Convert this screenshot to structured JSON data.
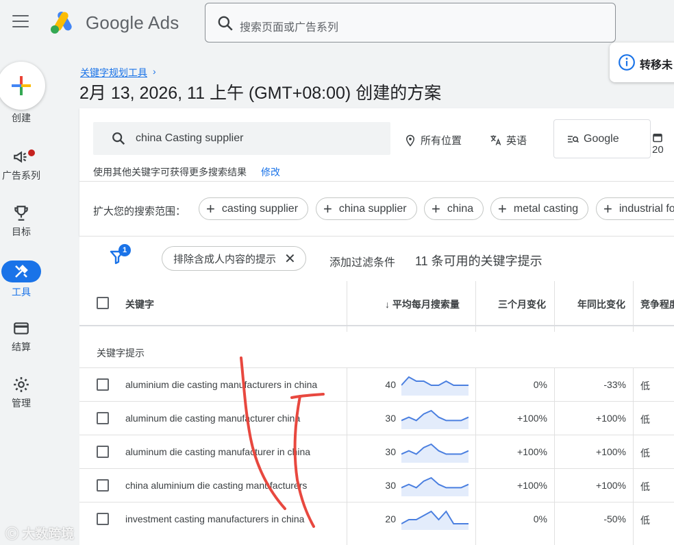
{
  "header": {
    "brand": "Google Ads",
    "search_placeholder": "搜索页面或广告系列",
    "toast_text": "转移未"
  },
  "sidebar": {
    "create_label": "创建",
    "items": [
      {
        "label": "广告系列",
        "icon": "megaphone-icon"
      },
      {
        "label": "目标",
        "icon": "trophy-icon"
      },
      {
        "label": "工具",
        "icon": "tools-icon",
        "active": true
      },
      {
        "label": "结算",
        "icon": "credit-card-icon"
      },
      {
        "label": "管理",
        "icon": "gear-icon"
      }
    ]
  },
  "page": {
    "breadcrumb": "关键字规划工具",
    "title": "2月 13, 2026, 11 上午 (GMT+08:00) 创建的方案"
  },
  "search_card": {
    "keyword_value": "china Casting supplier",
    "location": "所有位置",
    "language": "英语",
    "network": "Google",
    "date_partial": "20",
    "hint_text": "使用其他关键字可获得更多搜索结果",
    "hint_link": "修改",
    "expand_label": "扩大您的搜索范围：",
    "chips": [
      "casting supplier",
      "china supplier",
      "china",
      "metal casting",
      "industrial fo"
    ]
  },
  "filter_bar": {
    "badge_count": "1",
    "filter_chip": "排除含成人内容的提示",
    "add_filter": "添加过滤条件",
    "result_count": "11 条可用的关键字提示"
  },
  "table": {
    "headers": {
      "keyword": "关键字",
      "avg_monthly": "平均每月搜索量",
      "three_month": "三个月变化",
      "yoy": "年同比变化",
      "competition": "竞争程度"
    },
    "section_label": "关键字提示",
    "rows": [
      {
        "keyword": "aluminium die casting manufacturers in china",
        "volume": "40",
        "three_month": "0%",
        "yoy": "-33%",
        "competition": "低",
        "trend": [
          2,
          4,
          3,
          3,
          2,
          2,
          3,
          2,
          2,
          2
        ]
      },
      {
        "keyword": "aluminum die casting manufacturer china",
        "volume": "30",
        "three_month": "+100%",
        "yoy": "+100%",
        "competition": "低",
        "trend": [
          2,
          3,
          2,
          4,
          5,
          3,
          2,
          2,
          2,
          3
        ]
      },
      {
        "keyword": "aluminum die casting manufacturer in china",
        "volume": "30",
        "three_month": "+100%",
        "yoy": "+100%",
        "competition": "低",
        "trend": [
          2,
          3,
          2,
          4,
          5,
          3,
          2,
          2,
          2,
          3
        ]
      },
      {
        "keyword": "china aluminium die casting manufacturers",
        "volume": "30",
        "three_month": "+100%",
        "yoy": "+100%",
        "competition": "低",
        "trend": [
          2,
          3,
          2,
          4,
          5,
          3,
          2,
          2,
          2,
          3
        ]
      },
      {
        "keyword": "investment casting manufacturers in china",
        "volume": "20",
        "three_month": "0%",
        "yoy": "-50%",
        "competition": "低",
        "trend": [
          1,
          2,
          2,
          3,
          4,
          2,
          4,
          1,
          1,
          1
        ]
      }
    ]
  },
  "watermark": "大数跨境",
  "colors": {
    "accent": "#1a73e8",
    "spark_line": "#4a7fe0",
    "spark_fill": "#e3ecfb",
    "annotation": "#e8483f"
  }
}
